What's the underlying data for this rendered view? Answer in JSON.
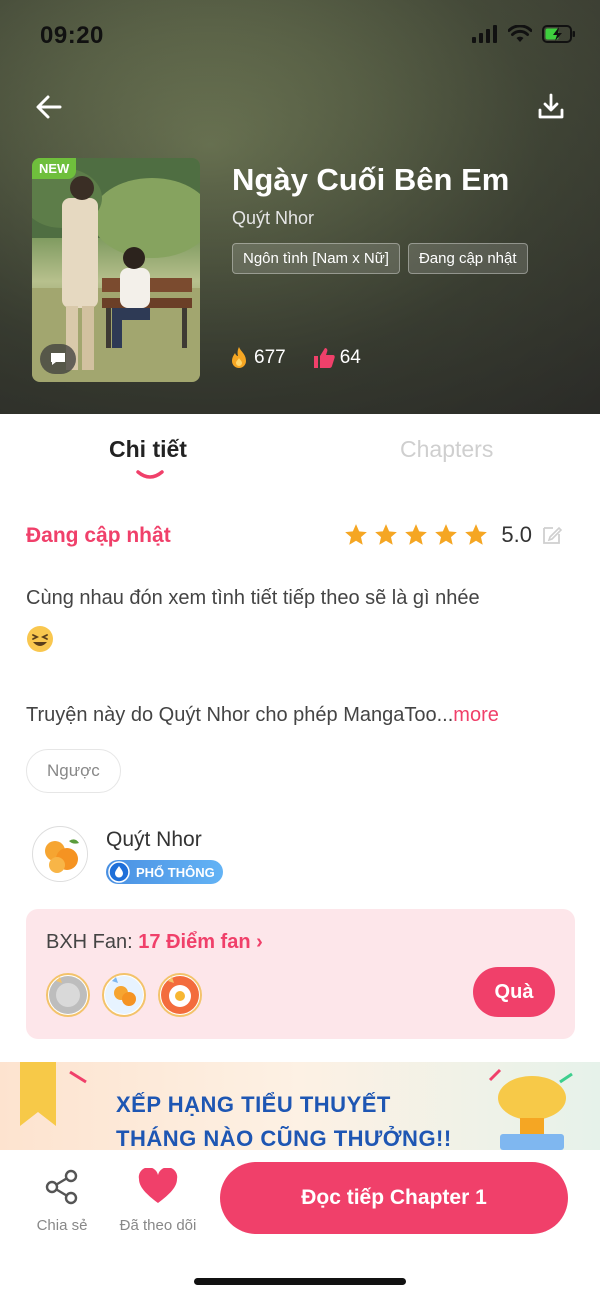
{
  "status_bar": {
    "time": "09:20"
  },
  "header": {
    "new_badge": "NEW",
    "title": "Ngày Cuối Bên Em",
    "author": "Quýt Nhor",
    "tags": [
      "Ngôn tình [Nam x Nữ]",
      "Đang cập nhật"
    ],
    "fire_count": "677",
    "like_count": "64"
  },
  "tabs": {
    "detail": "Chi tiết",
    "chapters": "Chapters"
  },
  "info": {
    "status": "Đang cập nhật",
    "rating": "5.0",
    "stars": 5,
    "description": "Cùng nhau đón xem tình tiết tiếp theo sẽ là gì nhée",
    "permission_text": "Truyện này do Quýt Nhor cho phép MangaToo...",
    "more": "more",
    "genre": "Ngược"
  },
  "author_section": {
    "name": "Quýt Nhor",
    "level": "PHỔ THÔNG"
  },
  "fan_box": {
    "label": "BXH Fan: ",
    "points": "17 Điểm fan ›",
    "gift_button": "Quà"
  },
  "banner": {
    "line1": "XẾP HẠNG TIỂU THUYẾT",
    "line2": "THÁNG NÀO CŨNG THƯỞNG!!"
  },
  "bottom_bar": {
    "share": "Chia sẻ",
    "follow": "Đã theo dõi",
    "read": "Đọc tiếp Chapter 1"
  },
  "colors": {
    "accent": "#f0406a",
    "fan_bg": "#fde6ea",
    "banner_text": "#1e56b3"
  }
}
